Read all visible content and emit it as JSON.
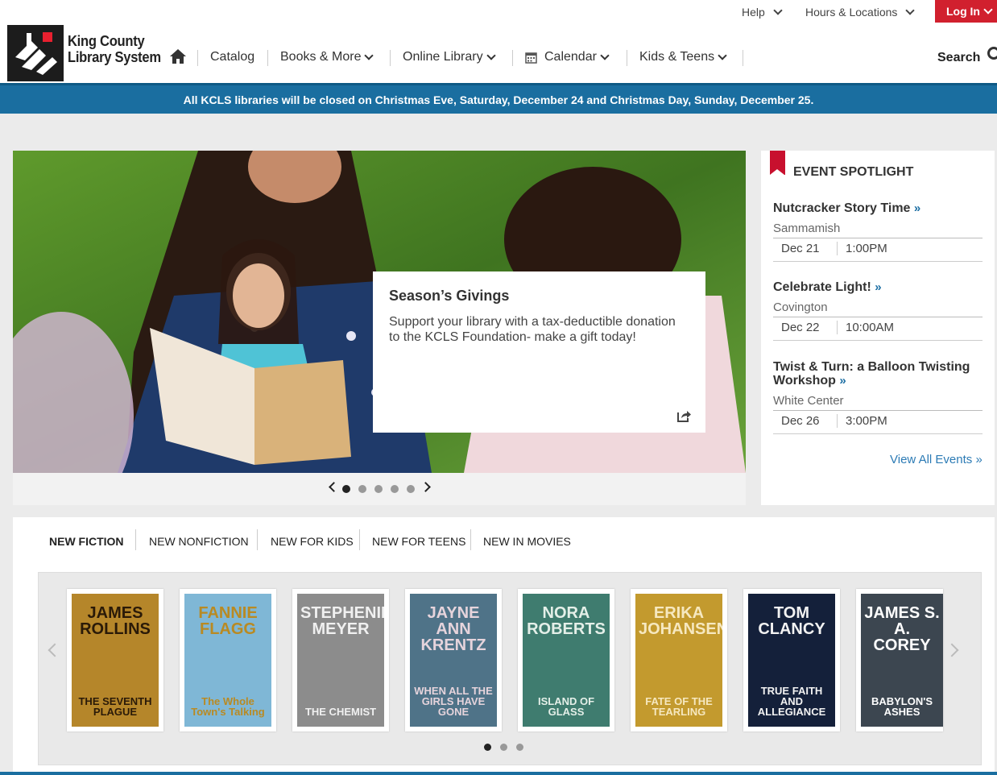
{
  "util": {
    "help": "Help",
    "hours": "Hours & Locations",
    "login": "Log In"
  },
  "logo": {
    "line1": "King County",
    "line2": "Library System"
  },
  "nav": {
    "catalog": "Catalog",
    "books": "Books & More",
    "online": "Online Library",
    "calendar": "Calendar",
    "kids": "Kids & Teens",
    "search": "Search"
  },
  "banner": {
    "text": "All KCLS libraries will be closed on Christmas Eve, Saturday, December 24 and Christmas Day, Sunday, December 25."
  },
  "hero": {
    "title": "Season’s Givings",
    "body": "Support your library with a tax-deductible donation to the KCLS Foundation- make a gift today!",
    "slides": 5,
    "active": 0
  },
  "events": {
    "heading": "EVENT SPOTLIGHT",
    "items": [
      {
        "title": "Nutcracker Story Time",
        "location": "Sammamish",
        "date": "Dec 21",
        "time": "1:00PM"
      },
      {
        "title": "Celebrate Light!",
        "location": "Covington",
        "date": "Dec 22",
        "time": "10:00AM"
      },
      {
        "title": "Twist & Turn: a Balloon Twisting Workshop",
        "location": "White Center",
        "date": "Dec 26",
        "time": "3:00PM"
      }
    ],
    "view_all": "View All Events »",
    "raquo": "»"
  },
  "newitems": {
    "tabs": [
      "NEW FICTION",
      "NEW NONFICTION",
      "NEW FOR KIDS",
      "NEW FOR TEENS",
      "NEW IN MOVIES"
    ],
    "books": [
      {
        "author": "JAMES ROLLINS",
        "title": "THE SEVENTH PLAGUE",
        "bg": "#b5862a",
        "fg": "#2a1a08"
      },
      {
        "author": "FANNIE FLAGG",
        "title": "The Whole Town's Talking",
        "bg": "#7fb7d6",
        "fg": "#b98a22"
      },
      {
        "author": "STEPHENIE MEYER",
        "title": "THE CHEMIST",
        "bg": "#8c8c8c",
        "fg": "#f0f0f0"
      },
      {
        "author": "JAYNE ANN KRENTZ",
        "title": "WHEN ALL THE GIRLS HAVE GONE",
        "bg": "#4f7388",
        "fg": "#e6d4dc"
      },
      {
        "author": "NORA ROBERTS",
        "title": "ISLAND OF GLASS",
        "bg": "#3f7c6f",
        "fg": "#e4efe8"
      },
      {
        "author": "ERIKA JOHANSEN",
        "title": "FATE OF THE TEARLING",
        "bg": "#c39a2e",
        "fg": "#f6e8c0"
      },
      {
        "author": "TOM CLANCY",
        "title": "TRUE FAITH AND ALLEGIANCE",
        "bg": "#14203a",
        "fg": "#f2f2f2"
      },
      {
        "author": "JAMES S. A. COREY",
        "title": "BABYLON'S ASHES",
        "bg": "#3c4650",
        "fg": "#ffffff"
      }
    ],
    "pages": 3,
    "active": 0
  },
  "colors": {
    "accent": "#d1202e",
    "banner": "#1a6ea0",
    "link": "#2c7bb5"
  }
}
